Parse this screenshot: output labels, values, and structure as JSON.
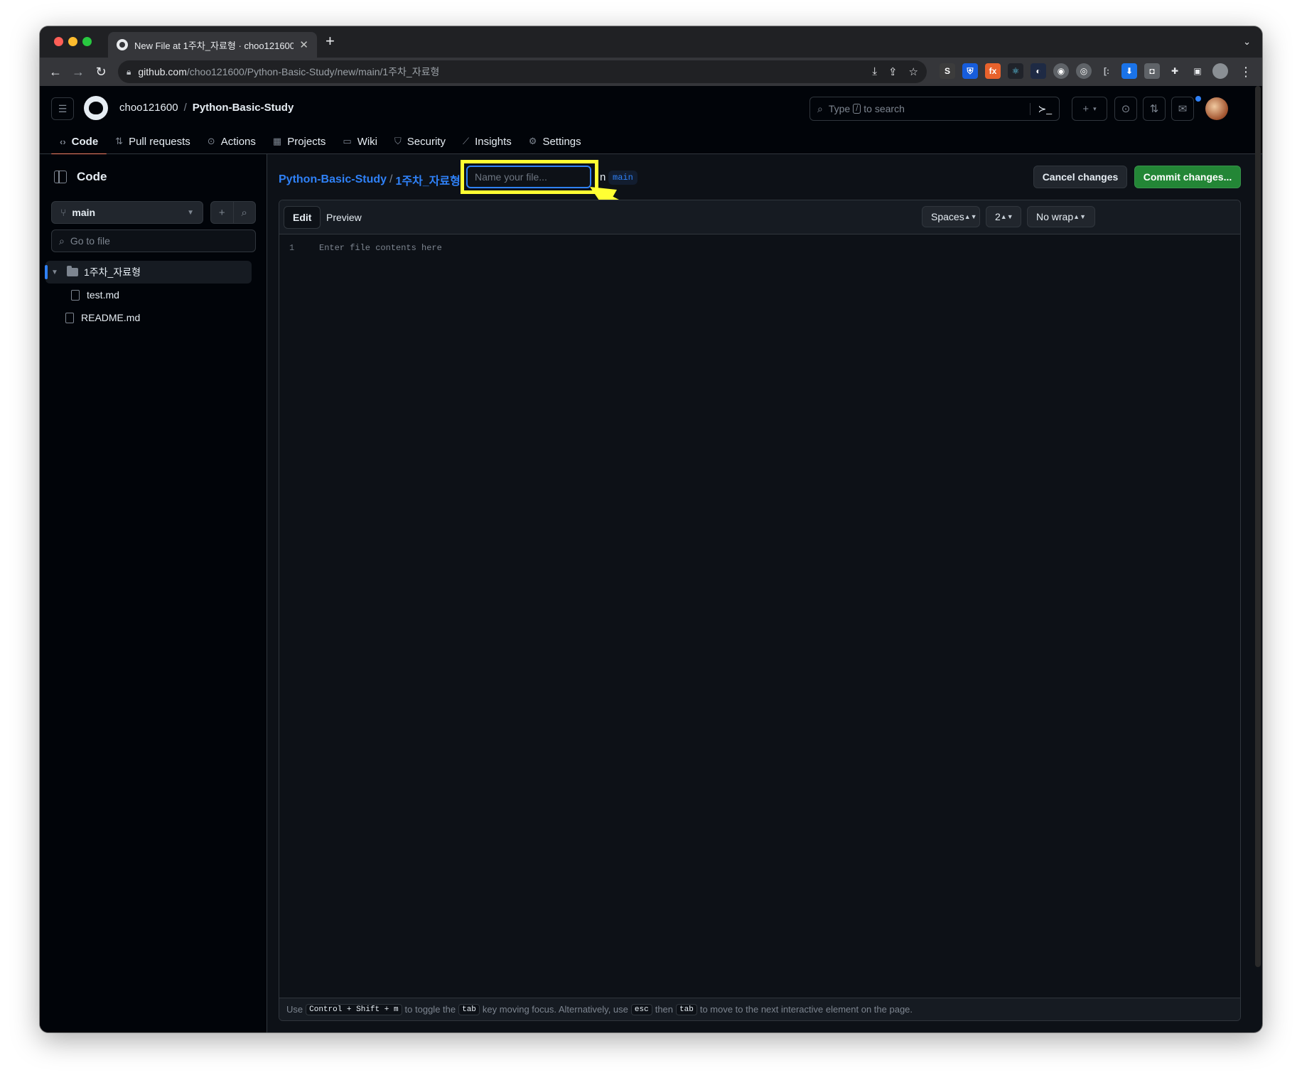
{
  "browser": {
    "tab_title": "New File at 1주차_자료형 · choo121600",
    "url_host": "github.com",
    "url_path": "/choo121600/Python-Basic-Study/new/main/1주차_자료형"
  },
  "header": {
    "owner": "choo121600",
    "separator": "/",
    "repo": "Python-Basic-Study",
    "search_prefix": "Type",
    "search_slash": "/",
    "search_suffix": "to search"
  },
  "repo_nav": [
    {
      "label": "Code",
      "icon": "code-icon"
    },
    {
      "label": "Pull requests",
      "icon": "pull-request-icon"
    },
    {
      "label": "Actions",
      "icon": "play-icon"
    },
    {
      "label": "Projects",
      "icon": "table-icon"
    },
    {
      "label": "Wiki",
      "icon": "book-icon"
    },
    {
      "label": "Security",
      "icon": "shield-icon"
    },
    {
      "label": "Insights",
      "icon": "graph-icon"
    },
    {
      "label": "Settings",
      "icon": "gear-icon"
    }
  ],
  "sidebar": {
    "title": "Code",
    "branch": "main",
    "goto_placeholder": "Go to file",
    "tree": [
      {
        "name": "1주차_자료형",
        "type": "folder",
        "expanded": true,
        "selected": true
      },
      {
        "name": "test.md",
        "type": "file"
      },
      {
        "name": "README.md",
        "type": "file"
      }
    ]
  },
  "main": {
    "breadcrumb_repo": "Python-Basic-Study",
    "breadcrumb_sep": "/",
    "breadcrumb_folder": "1주차_자료형",
    "filename_placeholder": "Name your file...",
    "in_text": "n",
    "branch_chip": "main",
    "cancel_label": "Cancel changes",
    "commit_label": "Commit changes..."
  },
  "editor": {
    "tab_edit": "Edit",
    "tab_preview": "Preview",
    "indent_mode": "Spaces",
    "indent_size": "2",
    "wrap_mode": "No wrap",
    "line_number": "1",
    "placeholder": "Enter file contents here",
    "footer": {
      "t1": "Use",
      "k1": "Control + Shift + m",
      "t2": "to toggle the",
      "k2": "tab",
      "t3": "key moving focus. Alternatively, use",
      "k3": "esc",
      "t4": "then",
      "k4": "tab",
      "t5": "to move to the next interactive element on the page."
    }
  },
  "colors": {
    "accent_blue": "#2f81f7",
    "commit_green": "#238636",
    "annotation_yellow": "#ffff33"
  }
}
